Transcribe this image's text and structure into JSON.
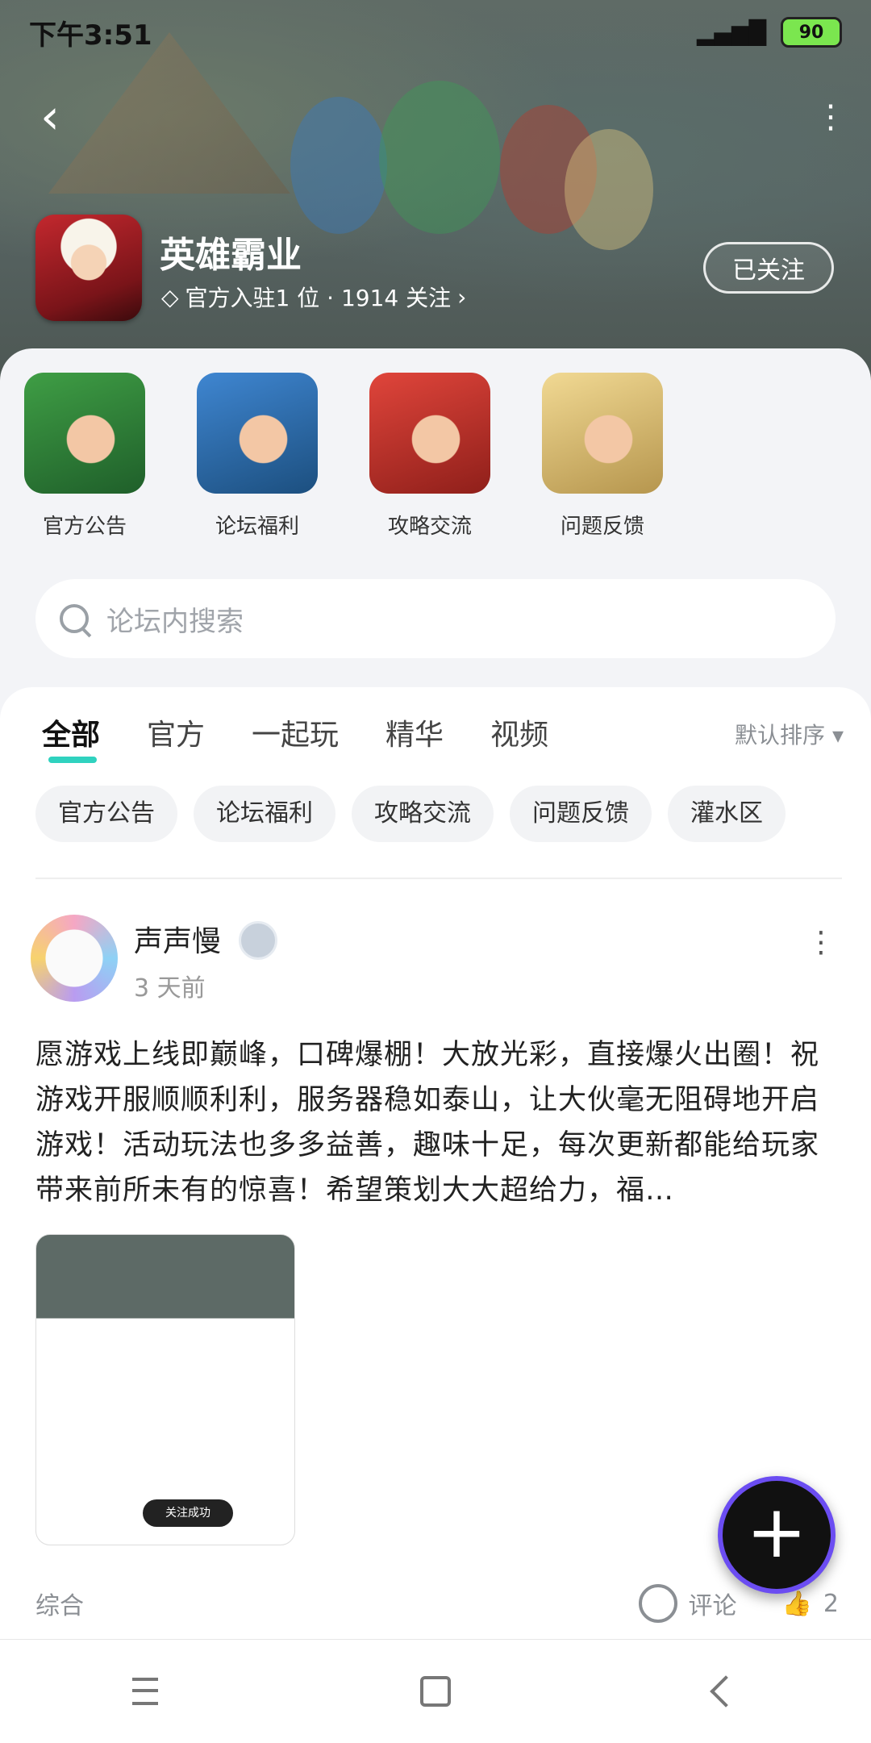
{
  "status": {
    "time": "下午3:51",
    "battery": "90"
  },
  "header": {
    "game_title": "英雄霸业",
    "meta": "官方入驻1 位 · 1914 关注",
    "follow_label": "已关注"
  },
  "categories": [
    {
      "label": "官方公告",
      "color": "#2f8b3b"
    },
    {
      "label": "论坛福利",
      "color": "#2a6fb6"
    },
    {
      "label": "攻略交流",
      "color": "#c9322b"
    },
    {
      "label": "问题反馈",
      "color": "#e8c36b"
    }
  ],
  "search": {
    "placeholder": "论坛内搜索"
  },
  "tabs": [
    "全部",
    "官方",
    "一起玩",
    "精华",
    "视频"
  ],
  "sort_label": "默认排序",
  "chips": [
    "官方公告",
    "论坛福利",
    "攻略交流",
    "问题反馈",
    "灌水区"
  ],
  "post": {
    "author": "声声慢",
    "time": "3 天前",
    "text": "愿游戏上线即巅峰，口碑爆棚！大放光彩，直接爆火出圈！祝游戏开服顺顺利利，服务器稳如泰山，让大伙毫无阻碍地开启游戏！活动玩法也多多益善，趣味十足，每次更新都能给玩家带来前所未有的惊喜！希望策划大大超给力，福…",
    "image_toast": "关注成功",
    "category": "综合",
    "comment_label": "评论",
    "like_count": "2"
  }
}
